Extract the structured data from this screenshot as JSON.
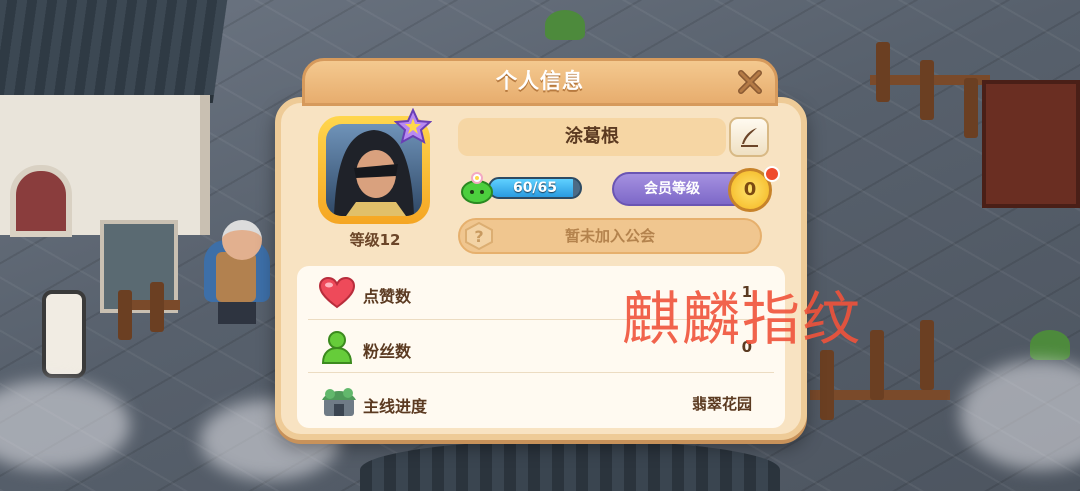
{
  "dialog": {
    "title": "个人信息"
  },
  "profile": {
    "name": "涂葛根",
    "level_label": "等级12",
    "stamina": {
      "text": "60/65",
      "current": 60,
      "max": 65
    },
    "vip": {
      "label": "会员等级",
      "level": "0"
    },
    "guild_status": "暂未加入公会",
    "guild_icon_glyph": "?"
  },
  "stats": [
    {
      "label": "点赞数",
      "value": "1",
      "icon": "heart-icon"
    },
    {
      "label": "粉丝数",
      "value": "0",
      "icon": "person-icon"
    },
    {
      "label": "主线进度",
      "value": "翡翠花园",
      "icon": "garden-icon"
    }
  ],
  "watermark": "麒麟指纹",
  "colors": {
    "header": "#e7ad6e",
    "panel": "#f8e3c2",
    "stamina_fill": "#2a9be0",
    "vip": "#7d68c8",
    "watermark": "#f0533b"
  }
}
